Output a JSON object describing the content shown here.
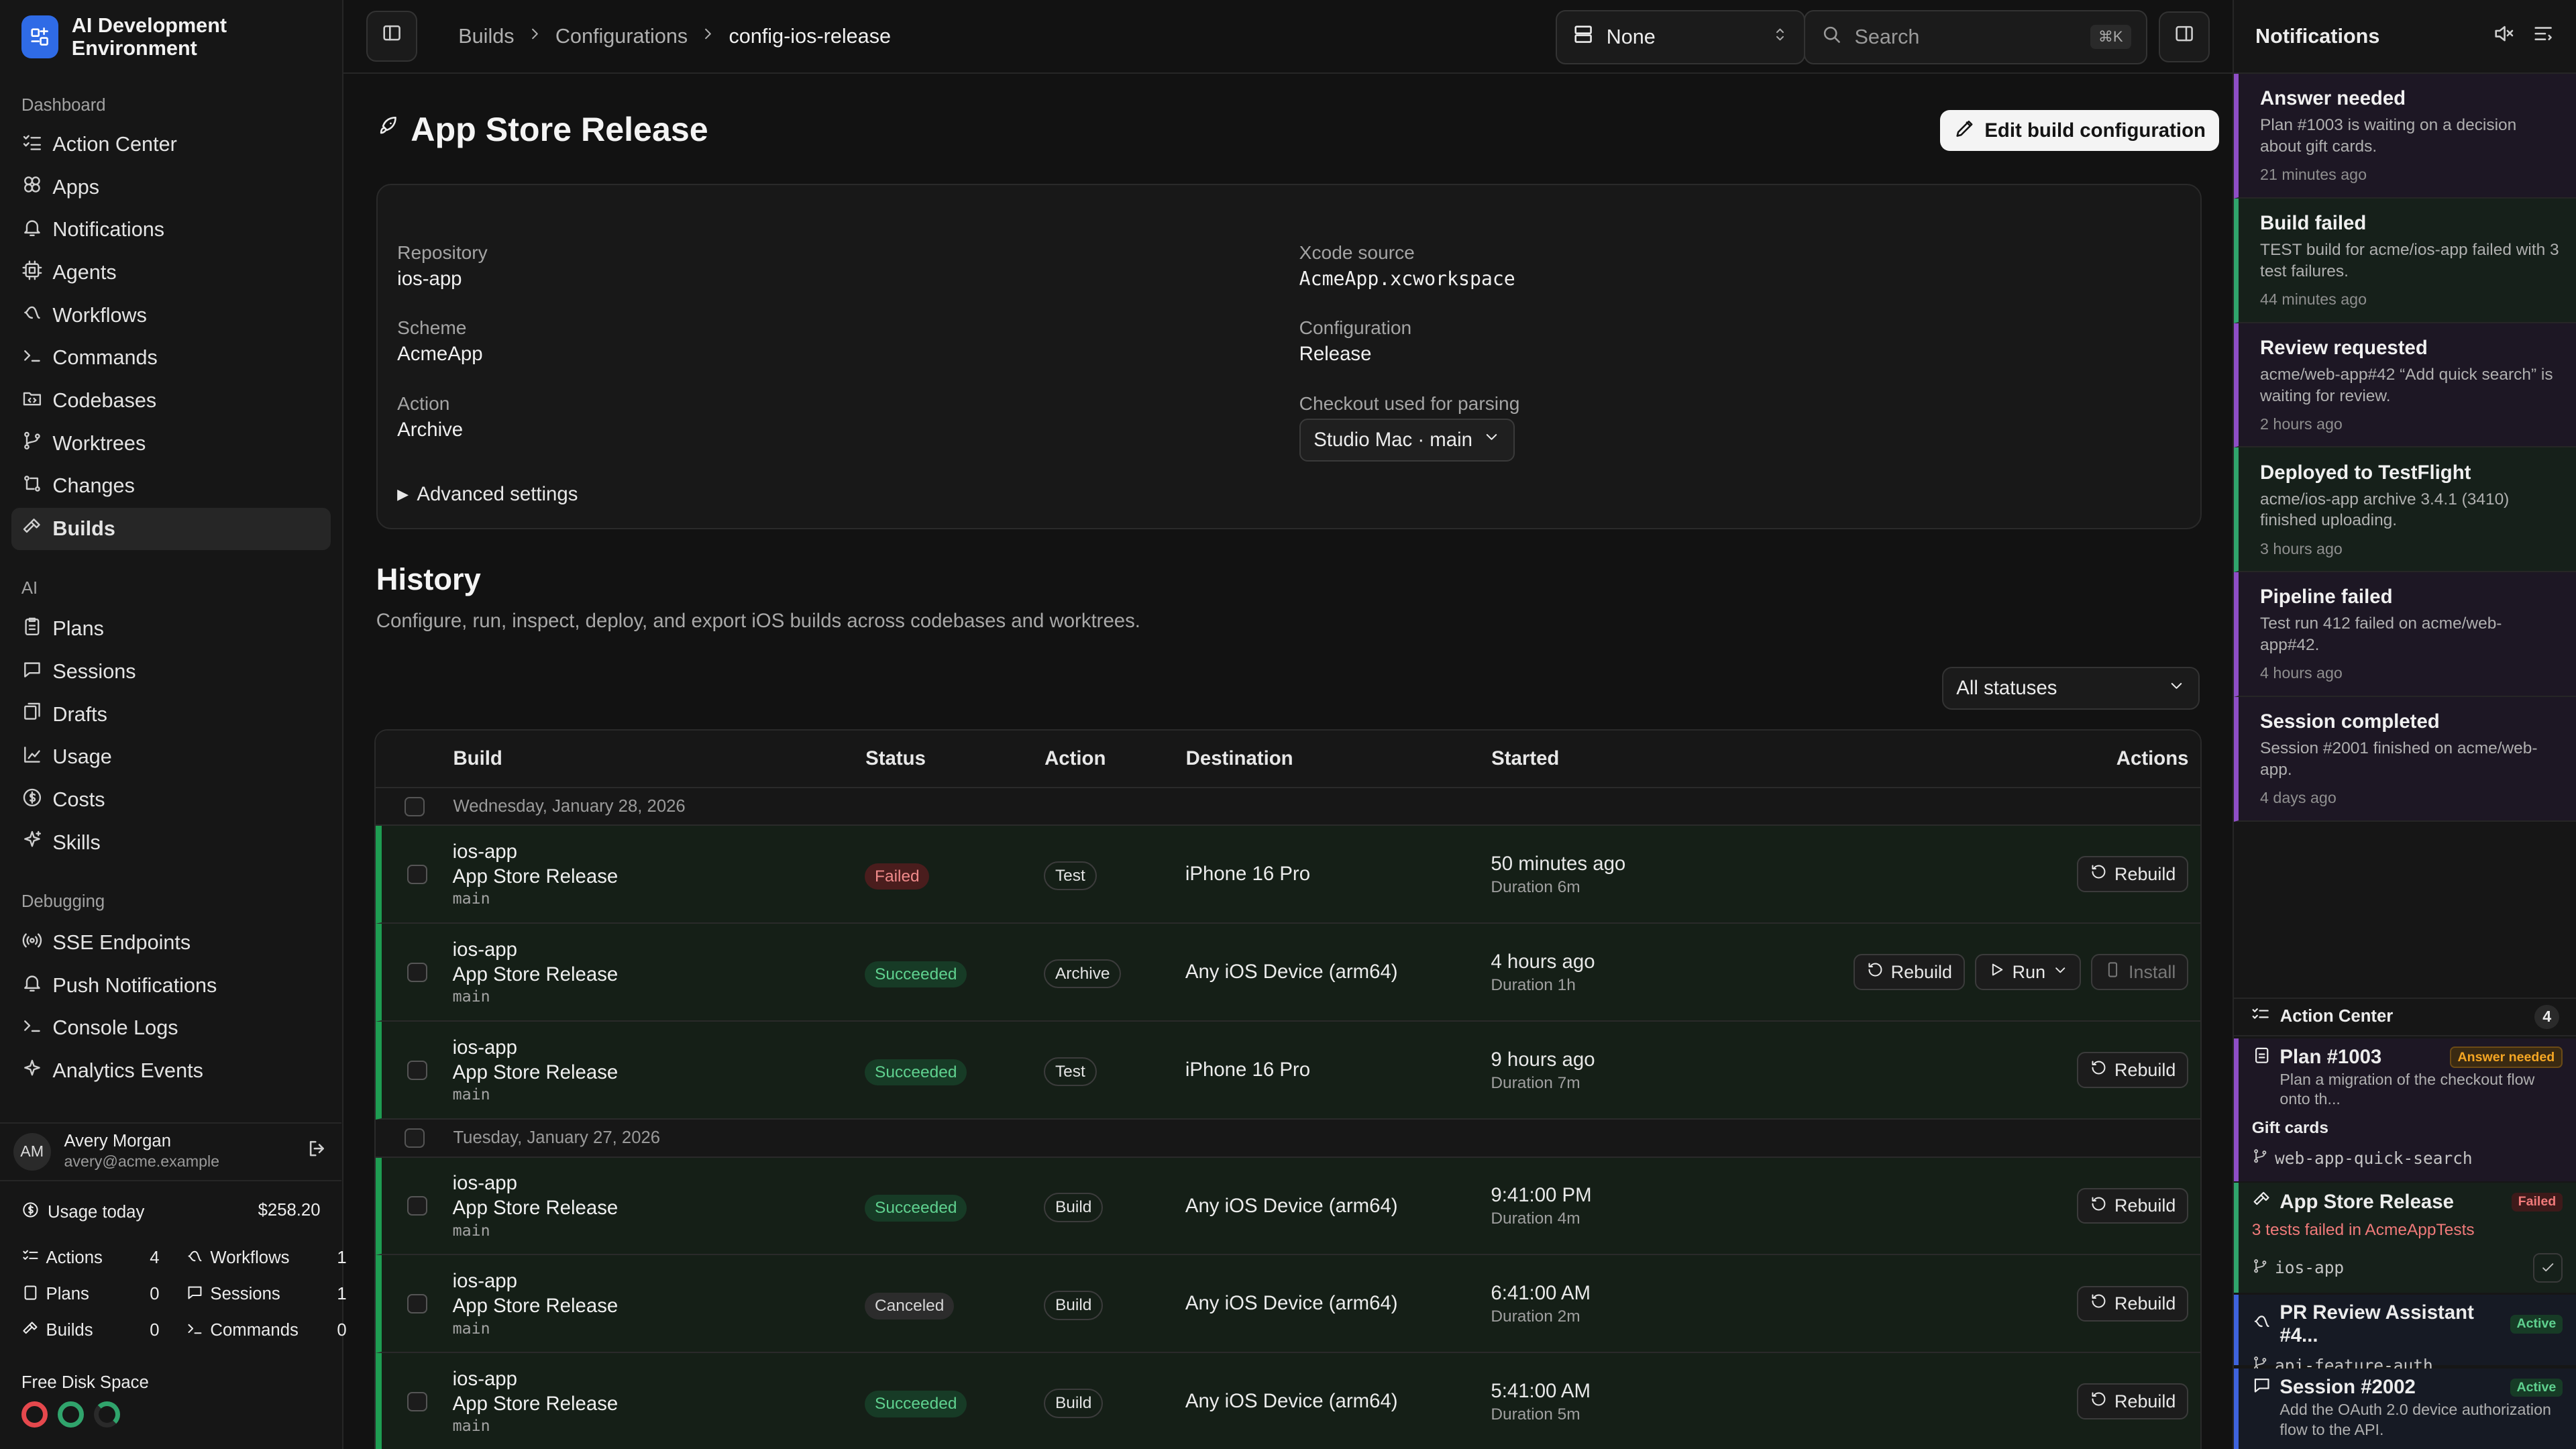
{
  "app": {
    "title": "AI Development Environment"
  },
  "sidebar": {
    "sections": [
      {
        "label": "Dashboard",
        "items": [
          {
            "label": "Action Center",
            "icon": "list-check-icon"
          },
          {
            "label": "Apps",
            "icon": "apps-icon"
          },
          {
            "label": "Notifications",
            "icon": "bell-icon"
          },
          {
            "label": "Agents",
            "icon": "cpu-icon"
          },
          {
            "label": "Workflows",
            "icon": "workflow-icon"
          },
          {
            "label": "Commands",
            "icon": "terminal-icon"
          },
          {
            "label": "Codebases",
            "icon": "folder-code-icon"
          },
          {
            "label": "Worktrees",
            "icon": "git-branch-icon"
          },
          {
            "label": "Changes",
            "icon": "git-compare-icon"
          },
          {
            "label": "Builds",
            "icon": "hammer-icon",
            "active": true
          }
        ]
      },
      {
        "label": "AI",
        "items": [
          {
            "label": "Plans",
            "icon": "clipboard-icon"
          },
          {
            "label": "Sessions",
            "icon": "chat-icon"
          },
          {
            "label": "Drafts",
            "icon": "drafts-icon"
          },
          {
            "label": "Usage",
            "icon": "chart-icon"
          },
          {
            "label": "Costs",
            "icon": "dollar-icon"
          },
          {
            "label": "Skills",
            "icon": "sparkle-icon"
          }
        ]
      },
      {
        "label": "Debugging",
        "items": [
          {
            "label": "SSE Endpoints",
            "icon": "radio-icon"
          },
          {
            "label": "Push Notifications",
            "icon": "bell-icon"
          },
          {
            "label": "Console Logs",
            "icon": "terminal-icon"
          },
          {
            "label": "Analytics Events",
            "icon": "sparkle-icon"
          }
        ]
      }
    ],
    "user": {
      "initials": "AM",
      "name": "Avery Morgan",
      "email": "avery@acme.example"
    },
    "usage": {
      "label": "Usage today",
      "amount": "$258.20",
      "stats": [
        {
          "label": "Actions",
          "value": "4"
        },
        {
          "label": "Workflows",
          "value": "1"
        },
        {
          "label": "Plans",
          "value": "0"
        },
        {
          "label": "Sessions",
          "value": "1"
        },
        {
          "label": "Builds",
          "value": "0"
        },
        {
          "label": "Commands",
          "value": "0"
        }
      ]
    },
    "disk": {
      "label": "Free Disk Space",
      "ring_colors": [
        "#e5484d",
        "#30a46c",
        "#30a46c"
      ]
    }
  },
  "topbar": {
    "breadcrumbs": [
      "Builds",
      "Configurations",
      "config-ios-release"
    ],
    "selector": "None",
    "search_placeholder": "Search",
    "shortcut": "⌘K"
  },
  "page": {
    "title": "App Store Release",
    "edit_button": "Edit build configuration",
    "fields": {
      "repository": {
        "label": "Repository",
        "value": "ios-app"
      },
      "scheme": {
        "label": "Scheme",
        "value": "AcmeApp"
      },
      "action": {
        "label": "Action",
        "value": "Archive"
      },
      "xcode_source": {
        "label": "Xcode source",
        "value": "AcmeApp.xcworkspace"
      },
      "configuration": {
        "label": "Configuration",
        "value": "Release"
      },
      "checkout": {
        "label": "Checkout used for parsing",
        "value": "Studio Mac · main"
      }
    },
    "advanced": "Advanced settings"
  },
  "history": {
    "title": "History",
    "subtitle": "Configure, run, inspect, deploy, and export iOS builds across codebases and worktrees.",
    "status_filter": "All statuses",
    "columns": [
      "Build",
      "Status",
      "Action",
      "Destination",
      "Started",
      "Actions"
    ],
    "groups": [
      {
        "date": "Wednesday, January 28, 2026",
        "rows": [
          {
            "repo": "ios-app",
            "name": "App Store Release",
            "branch": "main",
            "status": "Failed",
            "status_class": "failed",
            "action": "Test",
            "destination": "iPhone 16 Pro",
            "started": "50 minutes ago",
            "duration": "Duration 6m",
            "buttons": [
              "Rebuild"
            ]
          },
          {
            "repo": "ios-app",
            "name": "App Store Release",
            "branch": "main",
            "status": "Succeeded",
            "status_class": "succeeded",
            "action": "Archive",
            "destination": "Any iOS Device (arm64)",
            "started": "4 hours ago",
            "duration": "Duration 1h",
            "buttons": [
              "Rebuild",
              "Run",
              "Install"
            ]
          },
          {
            "repo": "ios-app",
            "name": "App Store Release",
            "branch": "main",
            "status": "Succeeded",
            "status_class": "succeeded",
            "action": "Test",
            "destination": "iPhone 16 Pro",
            "started": "9 hours ago",
            "duration": "Duration 7m",
            "buttons": [
              "Rebuild"
            ]
          }
        ]
      },
      {
        "date": "Tuesday, January 27, 2026",
        "rows": [
          {
            "repo": "ios-app",
            "name": "App Store Release",
            "branch": "main",
            "status": "Succeeded",
            "status_class": "succeeded",
            "action": "Build",
            "destination": "Any iOS Device (arm64)",
            "started": "9:41:00 PM",
            "duration": "Duration 4m",
            "buttons": [
              "Rebuild"
            ]
          },
          {
            "repo": "ios-app",
            "name": "App Store Release",
            "branch": "main",
            "status": "Canceled",
            "status_class": "canceled",
            "action": "Build",
            "destination": "Any iOS Device (arm64)",
            "started": "6:41:00 AM",
            "duration": "Duration 2m",
            "buttons": [
              "Rebuild"
            ]
          },
          {
            "repo": "ios-app",
            "name": "App Store Release",
            "branch": "main",
            "status": "Succeeded",
            "status_class": "succeeded",
            "action": "Build",
            "destination": "Any iOS Device (arm64)",
            "started": "5:41:00 AM",
            "duration": "Duration 5m",
            "buttons": [
              "Rebuild"
            ]
          }
        ]
      }
    ]
  },
  "notifications": {
    "title": "Notifications",
    "items": [
      {
        "title": "Answer needed",
        "desc": "Plan #1003 is waiting on a decision about gift cards.",
        "time": "21 minutes ago",
        "color": "#8e4ec6",
        "bg": "#1d1724"
      },
      {
        "title": "Build failed",
        "desc": "TEST build for acme/ios-app failed with 3 test failures.",
        "time": "44 minutes ago",
        "color": "#30a46c",
        "bg": "#16201a"
      },
      {
        "title": "Review requested",
        "desc": "acme/web-app#42 “Add quick search” is waiting for review.",
        "time": "2 hours ago",
        "color": "#8e4ec6",
        "bg": "#1d1724"
      },
      {
        "title": "Deployed to TestFlight",
        "desc": "acme/ios-app archive 3.4.1 (3410) finished uploading.",
        "time": "3 hours ago",
        "color": "#30a46c",
        "bg": "#16201a"
      },
      {
        "title": "Pipeline failed",
        "desc": "Test run 412 failed on acme/web-app#42.",
        "time": "4 hours ago",
        "color": "#8e4ec6",
        "bg": "#1d1724"
      },
      {
        "title": "Session completed",
        "desc": "Session #2001 finished on acme/web-app.",
        "time": "4 days ago",
        "color": "#8e4ec6",
        "bg": "#1d1724"
      }
    ],
    "action_center": {
      "title": "Action Center",
      "count": "4",
      "items": [
        {
          "title": "Plan #1003",
          "tag": "Answer needed",
          "desc": "Plan a migration of the checkout flow onto th...",
          "sub": "Gift cards",
          "ref": "web-app-quick-search"
        },
        {
          "title": "App Store Release",
          "tag": "Failed",
          "desc": "3 tests failed in AcmeAppTests",
          "ref": "ios-app"
        },
        {
          "title": "PR Review Assistant #4...",
          "tag": "Active",
          "ref": "api-feature-auth"
        },
        {
          "title": "Session #2002",
          "tag": "Active",
          "desc": "Add the OAuth 2.0 device authorization flow to the API."
        }
      ]
    }
  }
}
